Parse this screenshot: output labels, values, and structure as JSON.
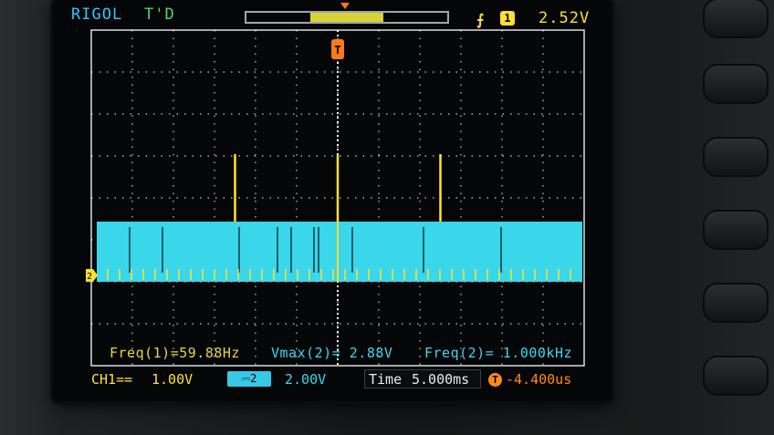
{
  "header": {
    "brand": "RIGOL",
    "trigger_status": "T'D",
    "memory_marker": "T",
    "trigger_level": "2.52V",
    "trigger_channel": "1",
    "trigger_type_icon": "rising-edge-icon"
  },
  "markers": {
    "trigger_top": "T",
    "ch2_ground": "2"
  },
  "measurements": {
    "freq1": "Freq(1)=59.88Hz",
    "vmax2": "Vmax(2)= 2.88V",
    "freq2": "Freq(2)= 1.000kHz"
  },
  "status": {
    "ch1_label": "CH1==",
    "ch1_scale": "1.00V",
    "ch2_icon": "ch2-coupling-icon",
    "ch2_scale": "2.00V",
    "time_label": "Time",
    "time_scale": "5.000ms",
    "trigger_offset": "-4.400us"
  },
  "waveform": {
    "ch1_color": "#ffe030",
    "ch2_color": "#3ad6ea",
    "grid_color": "#ffffff",
    "ch2_high_level": 2.88,
    "ch2_low_level": 0,
    "ch1_spikes_ms": [
      -12.5,
      0,
      12.5
    ]
  }
}
